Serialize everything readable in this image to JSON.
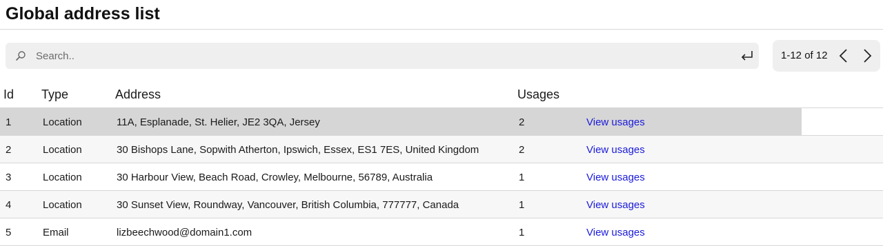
{
  "page": {
    "title": "Global address list"
  },
  "search": {
    "placeholder": "Search.."
  },
  "pager": {
    "label": "1-12 of 12"
  },
  "table": {
    "headers": {
      "id": "Id",
      "type": "Type",
      "address": "Address",
      "usages": "Usages"
    },
    "rows": [
      {
        "id": "1",
        "type": "Location",
        "address": "11A, Esplanade, St. Helier, JE2 3QA, Jersey",
        "usages": "2",
        "link": "View usages"
      },
      {
        "id": "2",
        "type": "Location",
        "address": "30 Bishops Lane, Sopwith Atherton, Ipswich, Essex, ES1 7ES, United Kingdom",
        "usages": "2",
        "link": "View usages"
      },
      {
        "id": "3",
        "type": "Location",
        "address": "30 Harbour View, Beach Road, Crowley, Melbourne, 56789, Australia",
        "usages": "1",
        "link": "View usages"
      },
      {
        "id": "4",
        "type": "Location",
        "address": "30 Sunset View, Roundway, Vancouver, British Columbia, 777777, Canada",
        "usages": "1",
        "link": "View usages"
      },
      {
        "id": "5",
        "type": "Email",
        "address": "lizbeechwood@domain1.com",
        "usages": "1",
        "link": "View usages"
      }
    ]
  },
  "colors": {
    "link": "#1a1adc",
    "selected_row": "#d6d6d6",
    "search_bg": "#efefef"
  },
  "icons": {
    "search": "search-icon",
    "enter": "enter-icon",
    "prev": "chevron-left-icon",
    "next": "chevron-right-icon"
  }
}
